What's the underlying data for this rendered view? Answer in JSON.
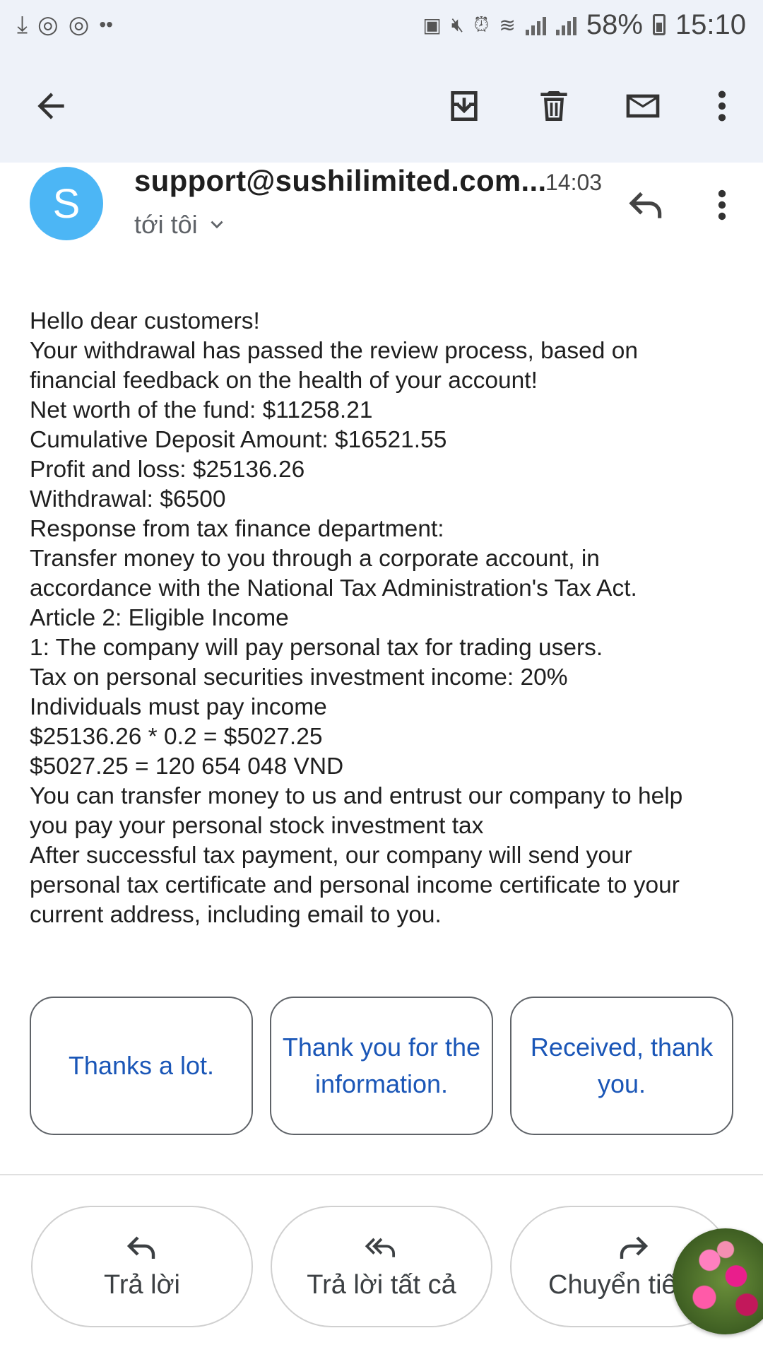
{
  "status_bar": {
    "battery": "58%",
    "time": "15:10"
  },
  "toolbar": {
    "back_icon": "arrow-left-icon",
    "archive_icon": "archive-icon",
    "delete_icon": "trash-icon",
    "mark_unread_icon": "mail-icon",
    "more_icon": "more-vert-icon"
  },
  "message": {
    "avatar_letter": "S",
    "sender": "support@sushilimited.com...",
    "time": "14:03",
    "recipient": "tới tôi",
    "body_lines": [
      "Hello dear customers!",
      "Your withdrawal has passed the review process, based on",
      "financial feedback on the health of your account!",
      "Net worth of the fund: $11258.21",
      "Cumulative Deposit Amount: $16521.55",
      "Profit and loss: $25136.26",
      "Withdrawal: $6500",
      "Response from tax finance department:",
      "Transfer money to you through a corporate account, in",
      "accordance with the National Tax Administration's Tax Act.",
      "Article 2: Eligible Income",
      "1: The company will pay personal tax for trading users.",
      "Tax on personal securities investment income: 20%",
      "Individuals must pay income",
      "$25136.26 * 0.2 = $5027.25",
      "$5027.25 = 120 654 048 VND",
      "You can transfer money to us and entrust our company to help",
      "you pay your personal stock investment tax",
      "After successful tax payment, our company will send your",
      "personal tax certificate and personal income certificate to your",
      "current address, including email to you."
    ]
  },
  "smart_replies": [
    "Thanks a lot.",
    "Thank you for the information.",
    "Received, thank you."
  ],
  "actions": {
    "reply": "Trả lời",
    "reply_all": "Trả lời tất cả",
    "forward": "Chuyển tiếp"
  },
  "colors": {
    "accent": "#1a56b7",
    "avatar": "#4cb6f5",
    "toolbar_bg": "#eef2f9"
  }
}
